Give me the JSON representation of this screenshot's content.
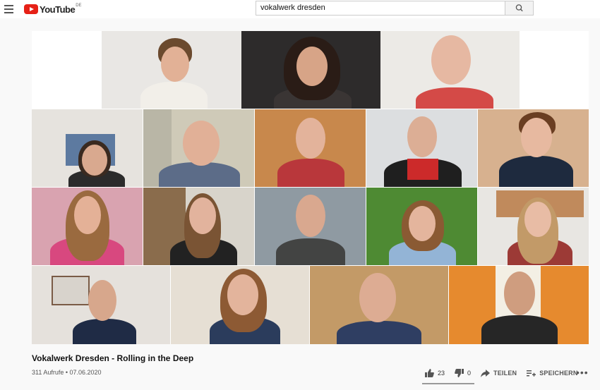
{
  "header": {
    "logo_text": "YouTube",
    "logo_region": "DE",
    "search_value": "vokalwerk dresden"
  },
  "video": {
    "title": "Vokalwerk Dresden - Rolling in the Deep",
    "meta": "311 Aufrufe • 07.06.2020",
    "likes": "23",
    "dislikes": "0",
    "share_label": "TEILEN",
    "save_label": "SPEICHERN",
    "more_label": "•••"
  },
  "colors": {
    "brand_red": "#e62117"
  }
}
